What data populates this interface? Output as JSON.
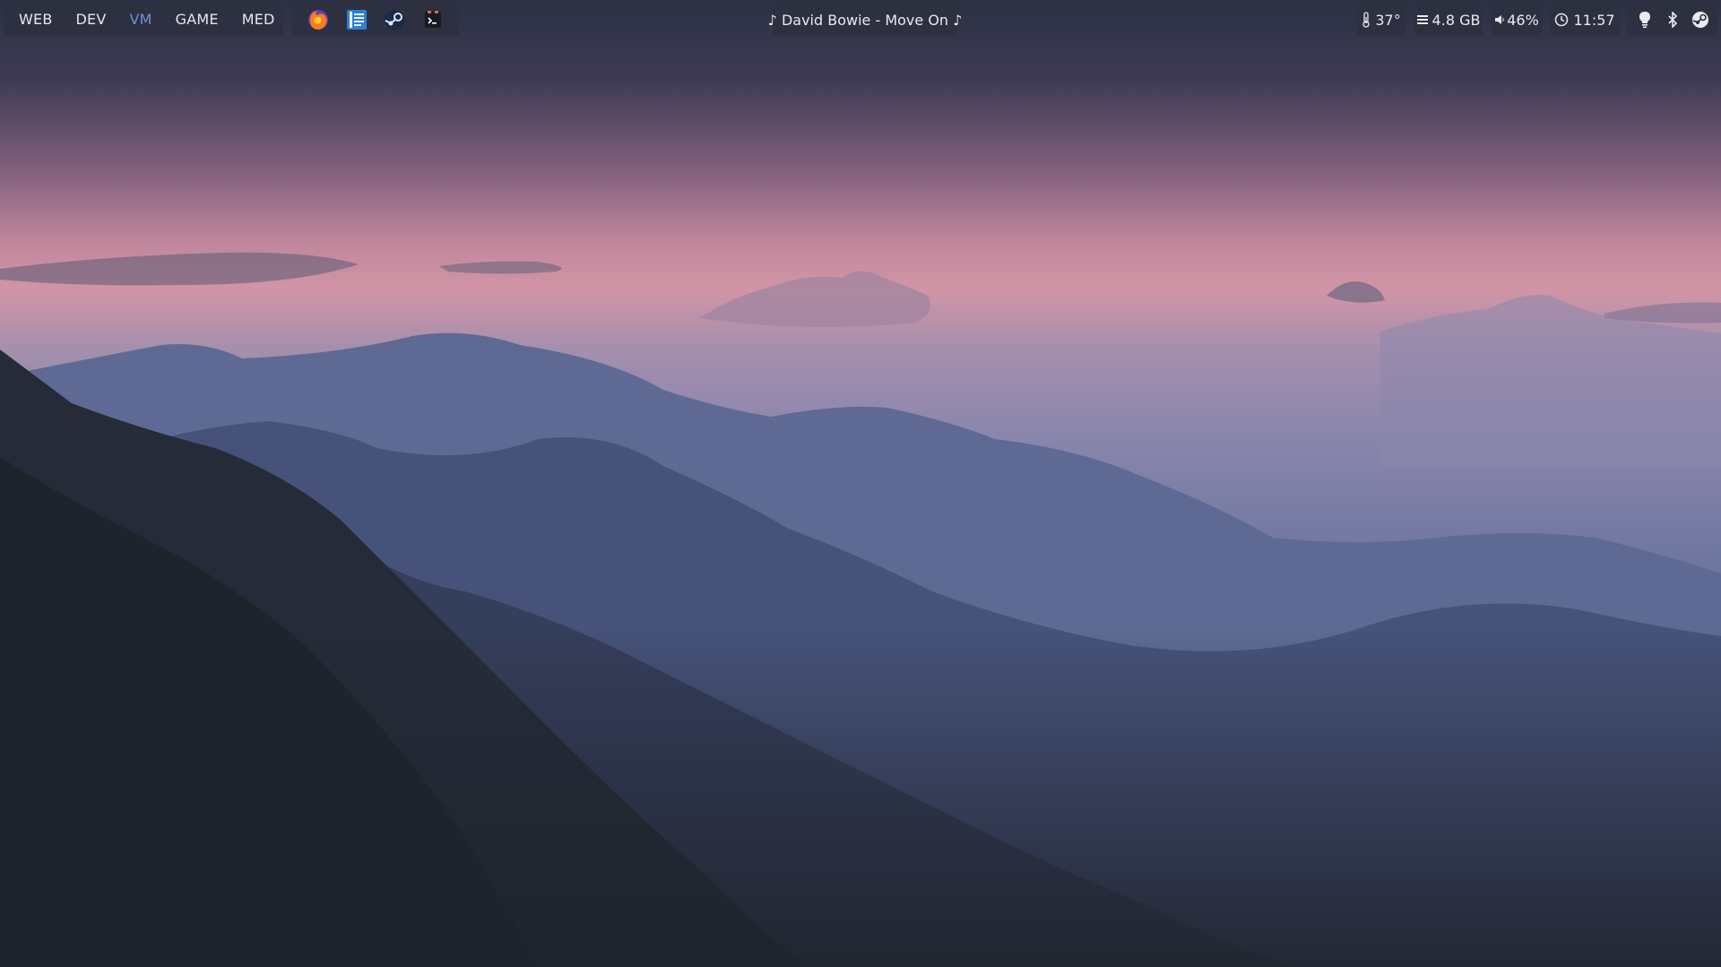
{
  "workspaces": [
    {
      "label": "WEB"
    },
    {
      "label": "DEV"
    },
    {
      "label": "VM"
    },
    {
      "label": "GAME"
    },
    {
      "label": "MED"
    }
  ],
  "active_workspace_color": "#6f8fdc",
  "apps": [
    {
      "icon": "firefox-icon"
    },
    {
      "icon": "text-editor-icon"
    },
    {
      "icon": "steam-icon"
    },
    {
      "icon": "terminal-icon"
    }
  ],
  "now_playing": "♪ David Bowie - Move On ♪",
  "status": {
    "temperature": "37°",
    "memory": "4.8 GB",
    "volume": "46%",
    "time": "11:57"
  },
  "tray": [
    {
      "icon": "lightbulb-icon"
    },
    {
      "icon": "bluetooth-icon"
    },
    {
      "icon": "steam-tray-icon"
    }
  ],
  "colors": {
    "bar_bg": "#2c2f3e",
    "text": "#e9e9ef",
    "sky_top": "#2e3346",
    "sky_glow": "#c98a9e",
    "mountain_far": "#6f7ea6",
    "mountain_near": "#1f232c"
  }
}
